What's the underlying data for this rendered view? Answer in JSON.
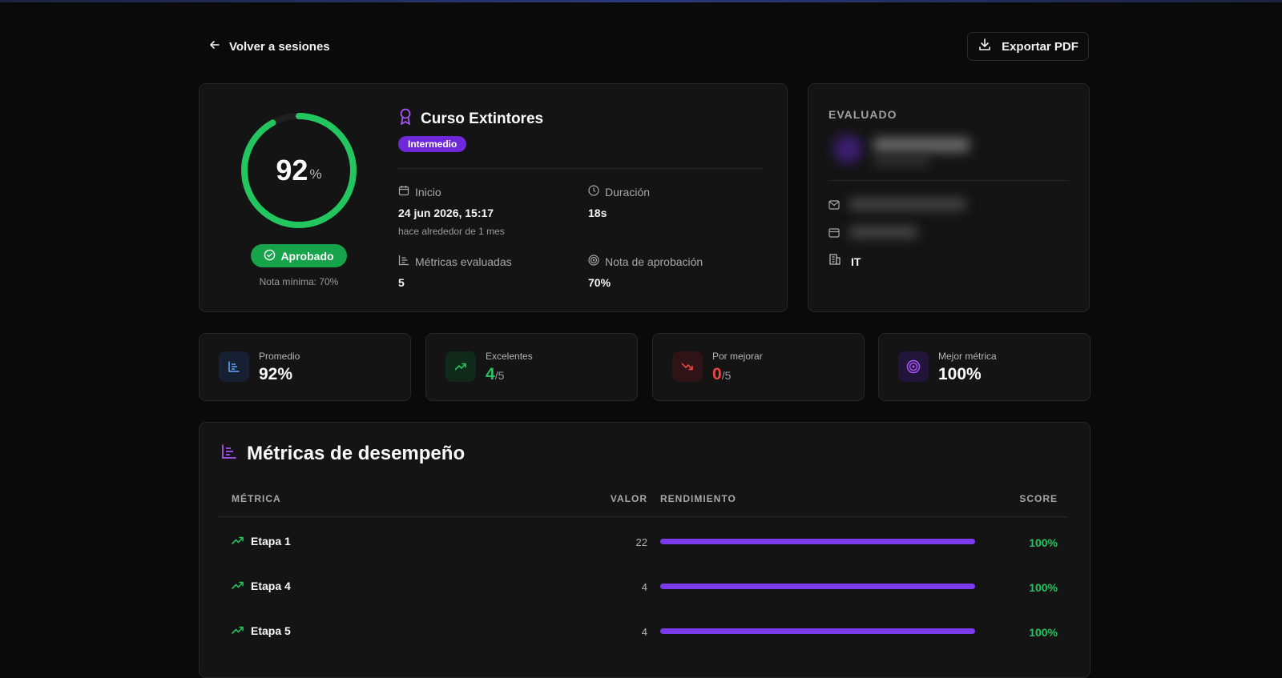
{
  "header": {
    "back_label": "Volver a sesiones",
    "export_label": "Exportar PDF"
  },
  "summary": {
    "score": "92",
    "score_unit": "%",
    "score_fraction": 0.92,
    "status": "Aprobado",
    "min_note": "Nota mínima: 70%",
    "course_title": "Curso Extintores",
    "level": "Intermedio",
    "start_label": "Inicio",
    "start_value": "24 jun 2026, 15:17",
    "start_relative": "hace alrededor de 1 mes",
    "duration_label": "Duración",
    "duration_value": "18s",
    "metrics_label": "Métricas evaluadas",
    "metrics_value": "5",
    "pass_label": "Nota de aprobación",
    "pass_value": "70%"
  },
  "evaluado": {
    "title": "EVALUADO",
    "department": "IT"
  },
  "stats": [
    {
      "label": "Promedio",
      "value": "92%",
      "denominator": "",
      "color": "#ffffff",
      "icon": "chart-icon"
    },
    {
      "label": "Excelentes",
      "value": "4",
      "denominator": "/5",
      "color": "#22c55e",
      "icon": "trending-up-icon"
    },
    {
      "label": "Por mejorar",
      "value": "0",
      "denominator": "/5",
      "color": "#ef4444",
      "icon": "trending-down-icon"
    },
    {
      "label": "Mejor métrica",
      "value": "100%",
      "denominator": "",
      "color": "#ffffff",
      "icon": "target-icon"
    }
  ],
  "metrics": {
    "title": "Métricas de desempeño",
    "columns": {
      "metric": "MÉTRICA",
      "value": "VALOR",
      "performance": "RENDIMIENTO",
      "score": "SCORE"
    },
    "rows": [
      {
        "name": "Etapa 1",
        "value": "22",
        "performance": 1.0,
        "score": "100%"
      },
      {
        "name": "Etapa 4",
        "value": "4",
        "performance": 1.0,
        "score": "100%"
      },
      {
        "name": "Etapa 5",
        "value": "4",
        "performance": 1.0,
        "score": "100%"
      }
    ]
  },
  "colors": {
    "accent": "#7c3aed",
    "success": "#22c55e",
    "danger": "#ef4444",
    "ring": "#22c55e"
  }
}
